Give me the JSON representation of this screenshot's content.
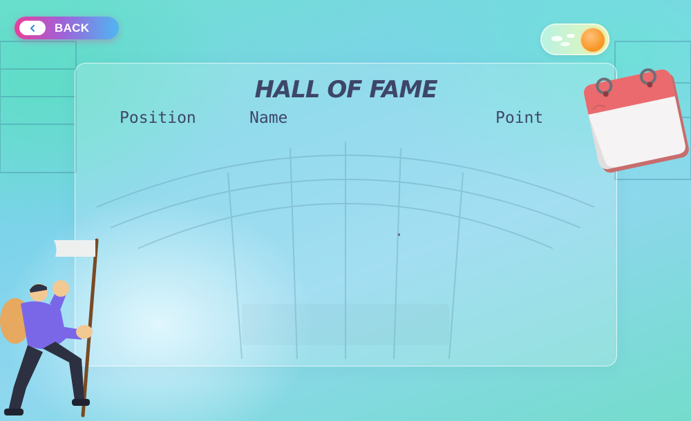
{
  "back_button": {
    "label": "BACK"
  },
  "panel": {
    "title": "HALL OF FAME",
    "columns": {
      "position": "Position",
      "name": "Name",
      "point": "Point"
    },
    "rows": []
  },
  "icons": {
    "back": "chevron-left-icon",
    "theme": "sun-icon",
    "calendar": "calendar-illustration",
    "hiker": "hiker-with-flag-illustration"
  },
  "colors": {
    "title": "#3e4668",
    "back_gradient_start": "#e83e9b",
    "back_gradient_end": "#4fb6f2",
    "sun": "#f7941e",
    "calendar_top": "#e9666a"
  }
}
